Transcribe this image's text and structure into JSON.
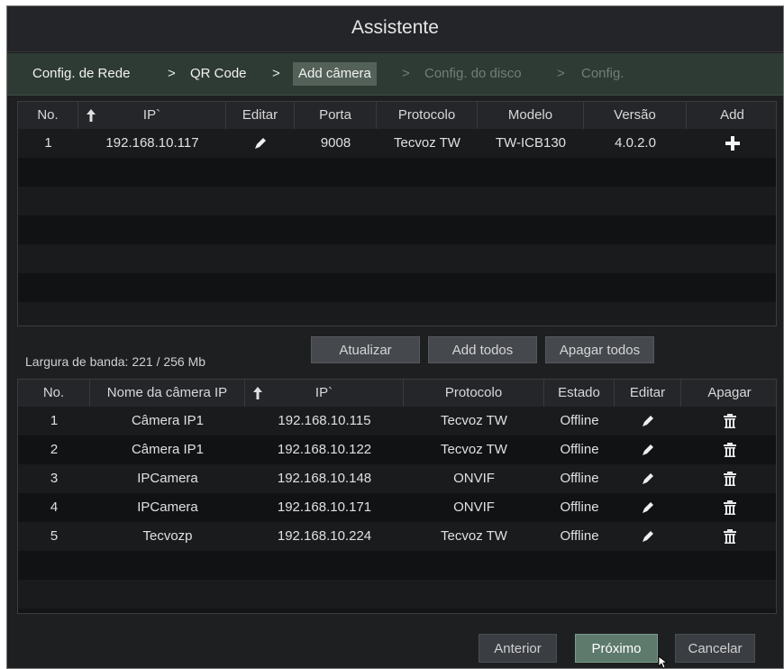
{
  "window": {
    "title": "Assistente"
  },
  "breadcrumbs": [
    {
      "label": "Config. de Rede",
      "state": "done"
    },
    {
      "label": "QR Code",
      "state": "done"
    },
    {
      "label": "Add câmera",
      "state": "active"
    },
    {
      "label": "Config. do disco",
      "state": "pending"
    },
    {
      "label": "Config.",
      "state": "pending"
    }
  ],
  "separator": ">",
  "search_table": {
    "columns": [
      "No.",
      "IP`",
      "Editar",
      "Porta",
      "Protocolo",
      "Modelo",
      "Versão",
      "Add"
    ],
    "sort_icon": "sort-up-arrow-icon",
    "rows": [
      {
        "no": "1",
        "ip": "192.168.10.117",
        "porta": "9008",
        "protocolo": "Tecvoz TW",
        "modelo": "TW-ICB130",
        "versao": "4.0.2.0"
      }
    ]
  },
  "bandwidth": "Largura de banda: 221 / 256 Mb",
  "actions": {
    "refresh": "Atualizar",
    "add_all": "Add todos",
    "delete_all": "Apagar todos"
  },
  "added_table": {
    "columns": [
      "No.",
      "Nome da câmera IP",
      "IP`",
      "Protocolo",
      "Estado",
      "Editar",
      "Apagar"
    ],
    "rows": [
      {
        "no": "1",
        "name": "Câmera IP1",
        "ip": "192.168.10.115",
        "protocolo": "Tecvoz TW",
        "estado": "Offline"
      },
      {
        "no": "2",
        "name": "Câmera IP1",
        "ip": "192.168.10.122",
        "protocolo": "Tecvoz TW",
        "estado": "Offline"
      },
      {
        "no": "3",
        "name": "IPCamera",
        "ip": "192.168.10.148",
        "protocolo": "ONVIF",
        "estado": "Offline"
      },
      {
        "no": "4",
        "name": "IPCamera",
        "ip": "192.168.10.171",
        "protocolo": "ONVIF",
        "estado": "Offline"
      },
      {
        "no": "5",
        "name": "Tecvozp",
        "ip": "192.168.10.224",
        "protocolo": "Tecvoz TW",
        "estado": "Offline"
      }
    ]
  },
  "footer": {
    "prev": "Anterior",
    "next": "Próximo",
    "cancel": "Cancelar"
  },
  "colors": {
    "accent": "#5d7a6d",
    "breadcrumb_bar": "#2e3b35",
    "background": "#1e1f21"
  }
}
